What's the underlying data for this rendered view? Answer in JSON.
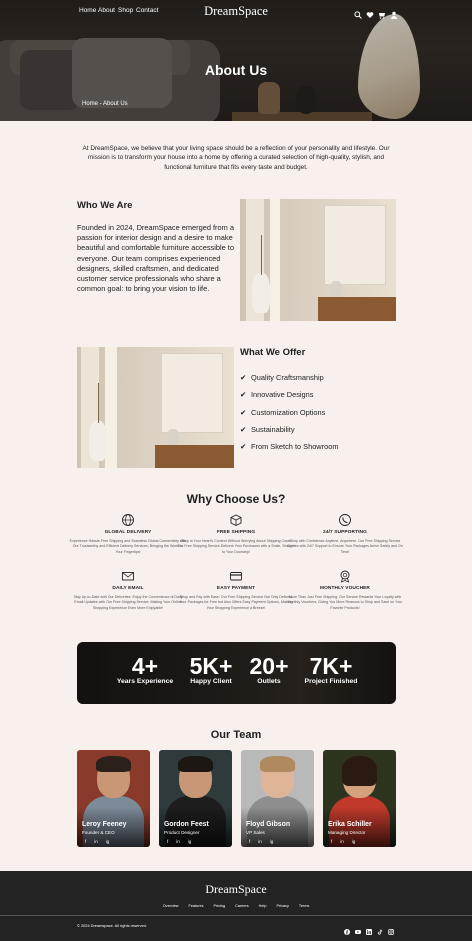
{
  "brand": {
    "name": "DreamSpace"
  },
  "nav": {
    "items": [
      "Home",
      "About",
      "Shop",
      "Contact"
    ]
  },
  "nav_icons": [
    "search-icon",
    "heart-icon",
    "cart-icon",
    "user-icon"
  ],
  "hero": {
    "title": "About Us",
    "breadcrumb": "Home - About Us"
  },
  "intro": "At DreamSpace, we believe that your living space should be a reflection of your personality and lifestyle. Our mission is to transform your house into a home by offering a curated selection of high-quality, stylish, and functional furniture that fits every taste and budget.",
  "who": {
    "title": "Who We Are",
    "text": "Founded in 2024, DreamSpace emerged from a passion for interior design and a desire to make beautiful and comfortable furniture accessible to everyone. Our team comprises experienced designers, skilled craftsmen, and dedicated customer service professionals who share a common goal: to bring your vision to life."
  },
  "offer": {
    "title": "What We Offer",
    "items": [
      "Quality Craftsmanship",
      "Innovative Designs",
      "Customization Options",
      "Sustainability",
      "From Sketch to Showroom"
    ]
  },
  "why": {
    "title": "Why Choose Us?",
    "features": [
      {
        "icon": "globe-icon",
        "title": "GLOBAL DELIVERY",
        "desc": "Experience Hassle-Free Shipping and Seamless Global Connectivity with Our Trustworthy and Efficient Delivery Services, Bringing the World to Your Fingertips!"
      },
      {
        "icon": "box-icon",
        "title": "FREE SHIPPING",
        "desc": "Shop to Your Heart's Content Without Worrying About Shipping Costs. Our Free Shipping Service Delivers Your Purchases with a Smile, Straight to Your Doorstep!"
      },
      {
        "icon": "phone-icon",
        "title": "24/7 SUPPORTING",
        "desc": "Shop with Confidence Anytime, Anywhere. Our Free Shipping Service Comes with 24/7 Support to Ensure Your Packages Arrive Safely and On Time!"
      },
      {
        "icon": "mail-icon",
        "title": "DAILY EMAIL",
        "desc": "Stay Up-to-Date with Our Deliveries: Enjoy the Convenience of Daily Email Updates with Our Free Shipping Service, Making Your Online Shopping Experience Even More Enjoyable!"
      },
      {
        "icon": "card-icon",
        "title": "EASY PAYMENT",
        "desc": "Shop and Pay with Ease: Our Free Shipping Service Not Only Delivers Your Packages for Free but Also Offers Easy Payment Options, Making Your Shopping Experience a Breeze!"
      },
      {
        "icon": "voucher-icon",
        "title": "MONTHLY VOUCHER",
        "desc": "More Than Just Free Shipping: Our Service Rewards Your Loyalty with Monthly Vouchers, Giving You More Reasons to Shop and Save on Your Favorite Products!"
      }
    ]
  },
  "stats": [
    {
      "number": "4+",
      "label": "Years Experience"
    },
    {
      "number": "5K+",
      "label": "Happy Client"
    },
    {
      "number": "20+",
      "label": "Outlets"
    },
    {
      "number": "7K+",
      "label": "Project Finished"
    }
  ],
  "team": {
    "title": "Our Team",
    "members": [
      {
        "name": "Leroy Feeney",
        "role": "Founder & CEO",
        "bg": "#8a3a2a",
        "shirt": "#7d8a98",
        "hair": "#2a211b"
      },
      {
        "name": "Gordon Feest",
        "role": "Product Designer",
        "bg": "#2e3a3c",
        "shirt": "#1d1d1d",
        "hair": "#1c1713"
      },
      {
        "name": "Floyd Gibson",
        "role": "VP Sales",
        "bg": "#b9b9b9",
        "shirt": "#8e8e8e",
        "hair": "#b08a5e"
      },
      {
        "name": "Erika Schiller",
        "role": "Managing Director",
        "bg": "#2c3420",
        "shirt": "#c0392b",
        "hair": "#2a1a12"
      }
    ],
    "social": [
      "f",
      "in",
      "ig"
    ]
  },
  "footer": {
    "links": [
      "Overview",
      "Features",
      "Pricing",
      "Careers",
      "Help",
      "Privacy",
      "Terms"
    ],
    "copyright": "© 2024 Dreamspace. All rights reserved.",
    "social_icons": [
      "facebook-icon",
      "youtube-icon",
      "linkedin-icon",
      "tiktok-icon",
      "instagram-icon"
    ]
  },
  "colors": {
    "page_bg": "#f8f0ec",
    "footer_bg": "#232323",
    "text": "#1e1e1e"
  }
}
